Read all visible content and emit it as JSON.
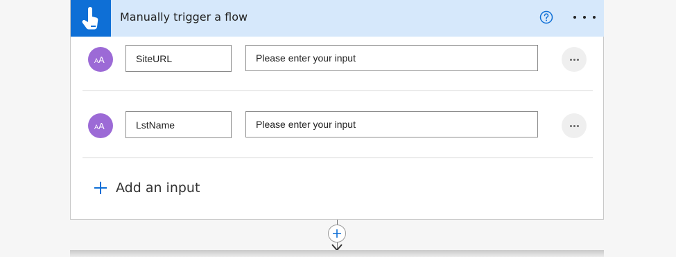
{
  "trigger": {
    "title": "Manually trigger a flow",
    "icon": "hand-pointer-icon",
    "accent": "#0e6fd6",
    "header_bg": "#d6e8fb"
  },
  "inputs": [
    {
      "name": "SiteURL",
      "placeholder": "Please enter your input",
      "type_icon": "text-type-icon"
    },
    {
      "name": "LstName",
      "placeholder": "Please enter your input",
      "type_icon": "text-type-icon"
    }
  ],
  "add_input": {
    "label": "Add an input"
  },
  "colors": {
    "avatar": "#9c6ad6",
    "text": "#222222"
  }
}
